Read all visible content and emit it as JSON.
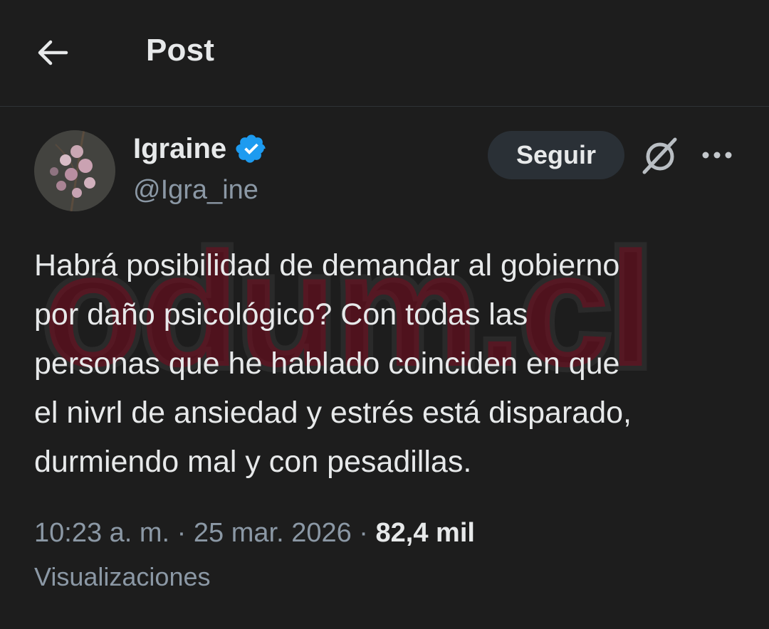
{
  "header": {
    "title": "Post",
    "back_icon": "arrow-left-icon"
  },
  "author": {
    "display_name": "Igraine",
    "handle": "@Igra_ine",
    "verified_icon": "verified-badge-icon",
    "verified_color": "#1d9bf0"
  },
  "actions": {
    "follow_label": "Seguir",
    "grok_icon": "grok-icon",
    "more_icon": "more-horizontal-icon"
  },
  "post": {
    "text": "Habrá posibilidad de demandar al gobierno\npor daño psicológico? Con todas las\npersonas que he hablado coinciden en que\nel nivrl de ansiedad y estrés está disparado,\ndurmiendo mal y con pesadillas."
  },
  "watermark": {
    "text": "odum.cl"
  },
  "meta": {
    "time": "10:23 a. m.",
    "sep1": " · ",
    "date": "25 mar. 2026",
    "sep2": " · ",
    "views_count": "82,4 mil",
    "views_label": "Visualizaciones"
  },
  "colors": {
    "background": "#1d1d1d",
    "text": "#e7e9ea",
    "secondary": "#8b98a5"
  }
}
